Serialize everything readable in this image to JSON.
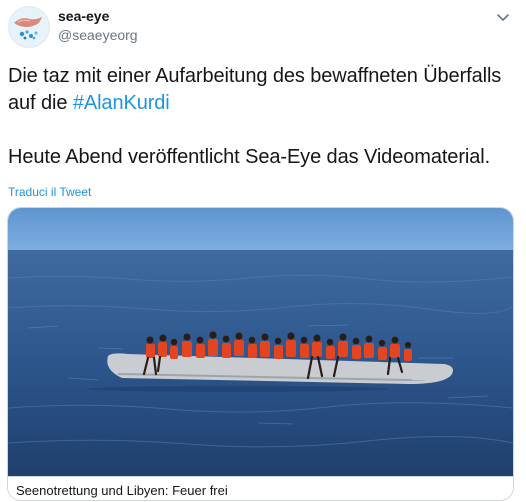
{
  "author": {
    "display_name": "sea-eye",
    "handle": "@seaeyeorg"
  },
  "tweet": {
    "line1_text": "Die taz mit einer Aufarbeitung des bewaffneten Überfalls auf die ",
    "hashtag": "#AlanKurdi",
    "line2_text": "Heute Abend veröffentlicht Sea-Eye das Videomaterial."
  },
  "translate_label": "Traduci il Tweet",
  "card": {
    "title": "Seenotrettung und Libyen: Feuer frei"
  },
  "icons": {
    "menu": "chevron-down-icon",
    "avatar": "sea-eye-logo"
  },
  "colors": {
    "link": "#1b95e0",
    "text": "#14171a",
    "secondary": "#657786",
    "border": "#ccd6dd",
    "sea": "#2f5b8f",
    "sky": "#6c9fd6",
    "lifejacket": "#e2451f"
  }
}
